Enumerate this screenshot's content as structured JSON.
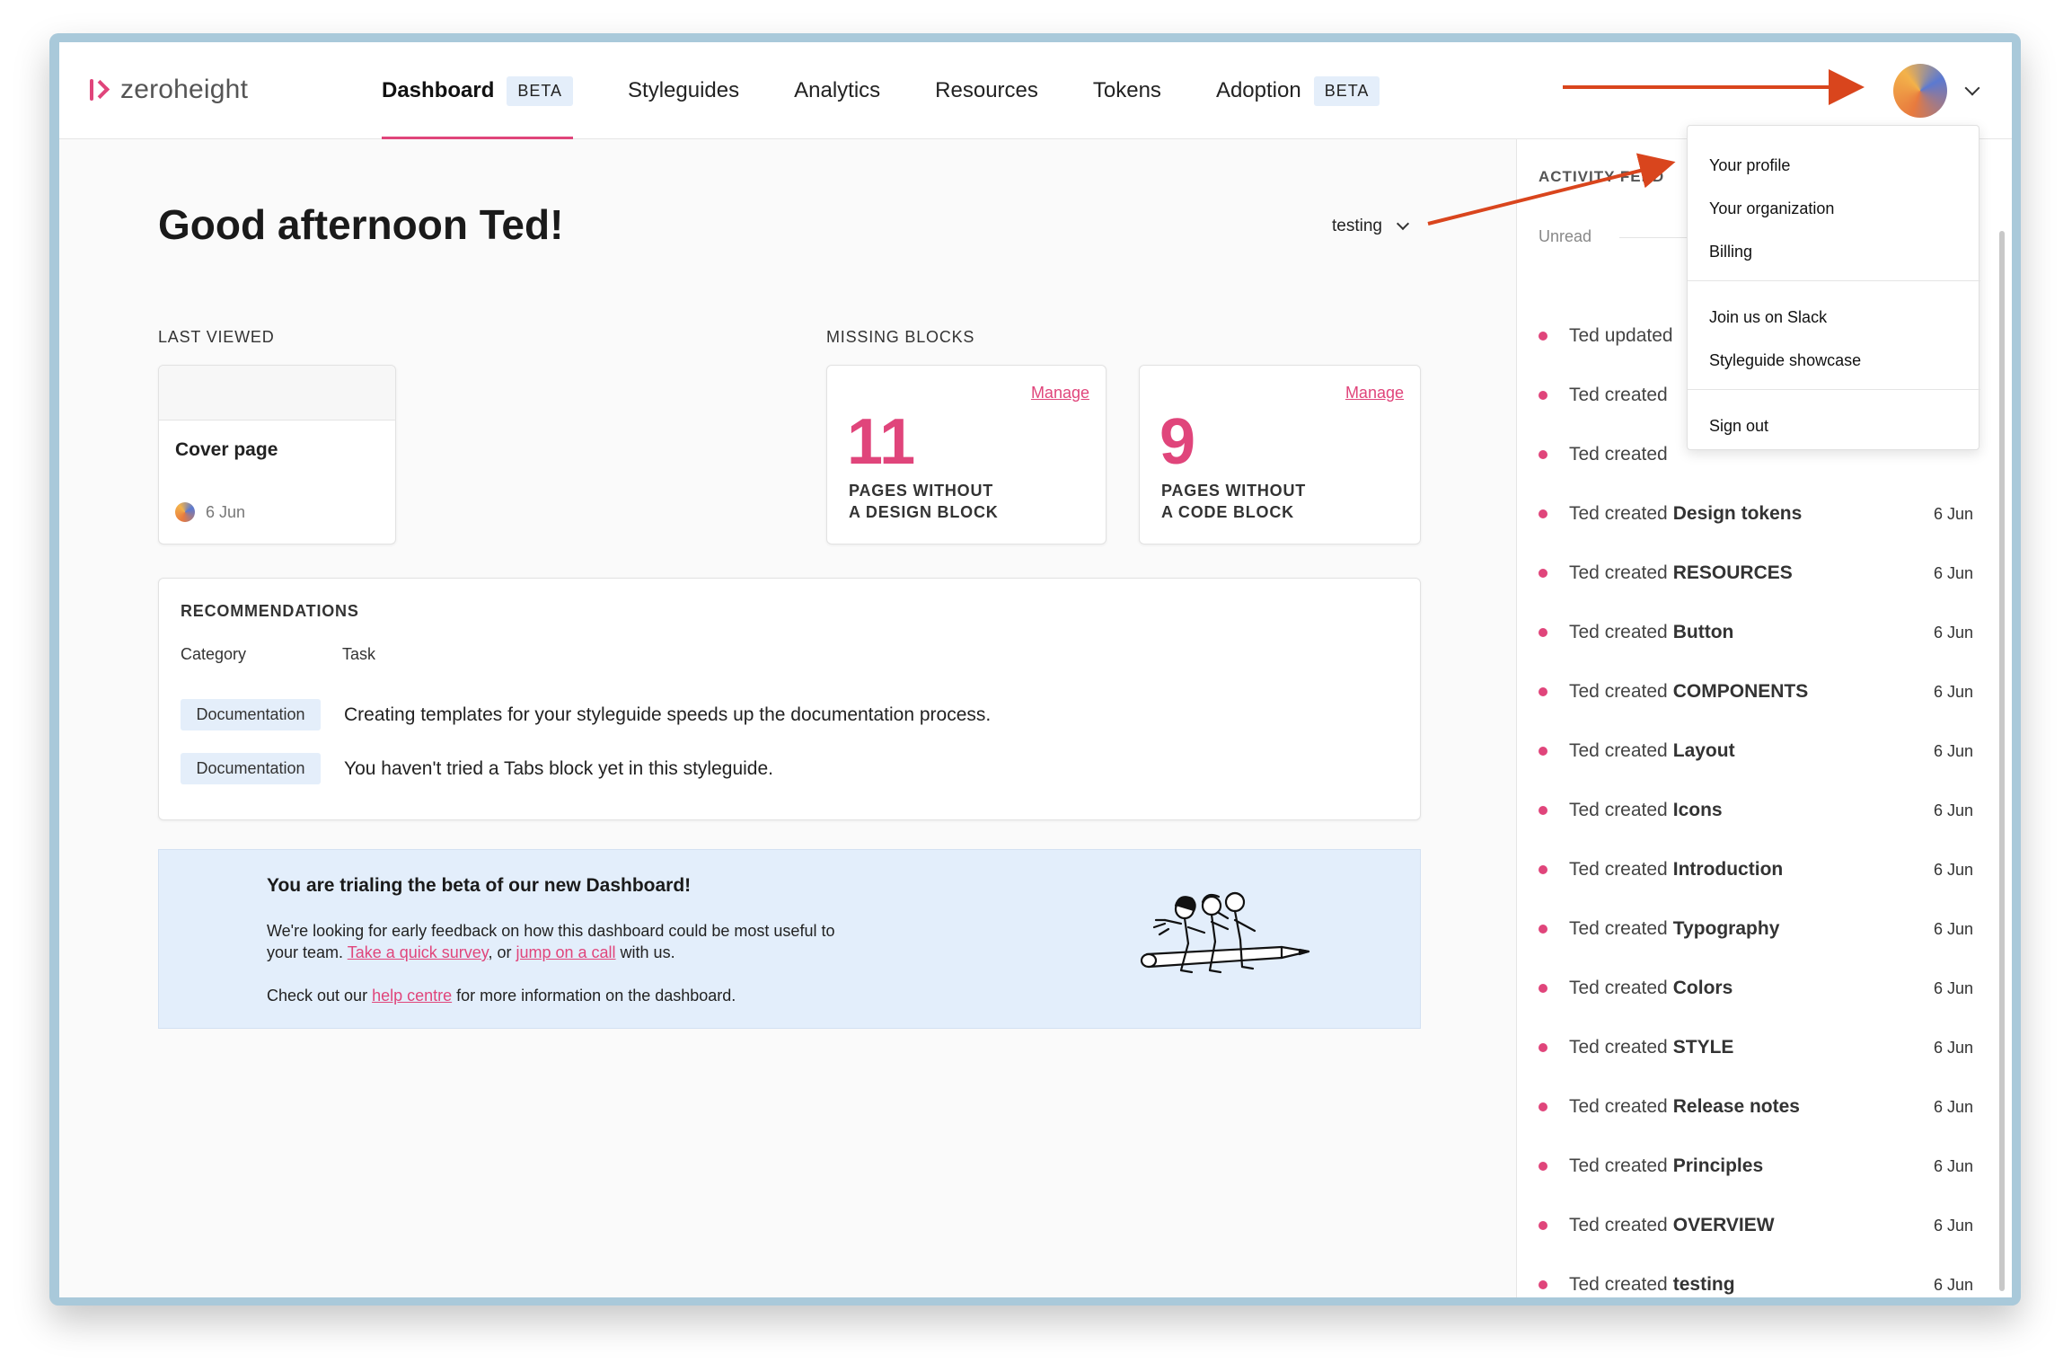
{
  "app": {
    "logo_text": "zeroheight"
  },
  "nav": {
    "items": [
      {
        "label": "Dashboard",
        "badge": "BETA",
        "active": true
      },
      {
        "label": "Styleguides"
      },
      {
        "label": "Analytics"
      },
      {
        "label": "Resources"
      },
      {
        "label": "Tokens"
      },
      {
        "label": "Adoption",
        "badge": "BETA"
      }
    ]
  },
  "main": {
    "greeting": "Good afternoon Ted!",
    "styleguide_select": "testing",
    "last_viewed": {
      "label": "LAST VIEWED",
      "card": {
        "title": "Cover page",
        "date": "6 Jun"
      }
    },
    "missing_blocks": {
      "label": "MISSING BLOCKS",
      "cards": [
        {
          "manage": "Manage",
          "count": "11",
          "line1": "PAGES WITHOUT",
          "line2": "A DESIGN BLOCK"
        },
        {
          "manage": "Manage",
          "count": "9",
          "line1": "PAGES WITHOUT",
          "line2": "A CODE BLOCK"
        }
      ]
    },
    "recommendations": {
      "title": "RECOMMENDATIONS",
      "col_category": "Category",
      "col_task": "Task",
      "rows": [
        {
          "category": "Documentation",
          "task": "Creating templates for your styleguide speeds up the documentation process."
        },
        {
          "category": "Documentation",
          "task": "You haven't tried a Tabs block yet in this styleguide."
        }
      ]
    },
    "banner": {
      "title": "You are trialing the beta of our new Dashboard!",
      "text1_a": "We're looking for early feedback on how this dashboard could be most useful to your team. ",
      "link_survey": "Take a quick survey",
      "text1_b": ", or ",
      "link_call": "jump on a call",
      "text1_c": " with us.",
      "text2_a": "Check out our ",
      "link_help": "help centre",
      "text2_b": " for more information on the dashboard."
    }
  },
  "feed": {
    "title": "ACTIVITY FEED",
    "unread_label": "Unread",
    "items": [
      {
        "prefix": "Ted updated",
        "name": "",
        "date": ""
      },
      {
        "prefix": "Ted created",
        "name": "",
        "date": ""
      },
      {
        "prefix": "Ted created",
        "name": "",
        "date": ""
      },
      {
        "prefix": "Ted created",
        "name": "Design tokens",
        "date": "6 Jun"
      },
      {
        "prefix": "Ted created",
        "name": "RESOURCES",
        "date": "6 Jun"
      },
      {
        "prefix": "Ted created",
        "name": "Button",
        "date": "6 Jun"
      },
      {
        "prefix": "Ted created",
        "name": "COMPONENTS",
        "date": "6 Jun"
      },
      {
        "prefix": "Ted created",
        "name": "Layout",
        "date": "6 Jun"
      },
      {
        "prefix": "Ted created",
        "name": "Icons",
        "date": "6 Jun"
      },
      {
        "prefix": "Ted created",
        "name": "Introduction",
        "date": "6 Jun"
      },
      {
        "prefix": "Ted created",
        "name": "Typography",
        "date": "6 Jun"
      },
      {
        "prefix": "Ted created",
        "name": "Colors",
        "date": "6 Jun"
      },
      {
        "prefix": "Ted created",
        "name": "STYLE",
        "date": "6 Jun"
      },
      {
        "prefix": "Ted created",
        "name": "Release notes",
        "date": "6 Jun"
      },
      {
        "prefix": "Ted created",
        "name": "Principles",
        "date": "6 Jun"
      },
      {
        "prefix": "Ted created",
        "name": "OVERVIEW",
        "date": "6 Jun"
      },
      {
        "prefix": "Ted created",
        "name": "testing",
        "date": "6 Jun"
      }
    ]
  },
  "user_menu": {
    "group1": [
      "Your profile",
      "Your organization",
      "Billing"
    ],
    "group2": [
      "Join us on Slack",
      "Styleguide showcase"
    ],
    "group3": [
      "Sign out"
    ]
  },
  "colors": {
    "accent": "#e0457b",
    "badge_bg": "#e4eefa",
    "annotation_arrow": "#d9451d"
  },
  "icons": {
    "logo": "zeroheight-logo-icon",
    "avatar": "user-avatar",
    "caret": "chevron-down-icon",
    "feed_dot": "unread-dot-icon"
  }
}
